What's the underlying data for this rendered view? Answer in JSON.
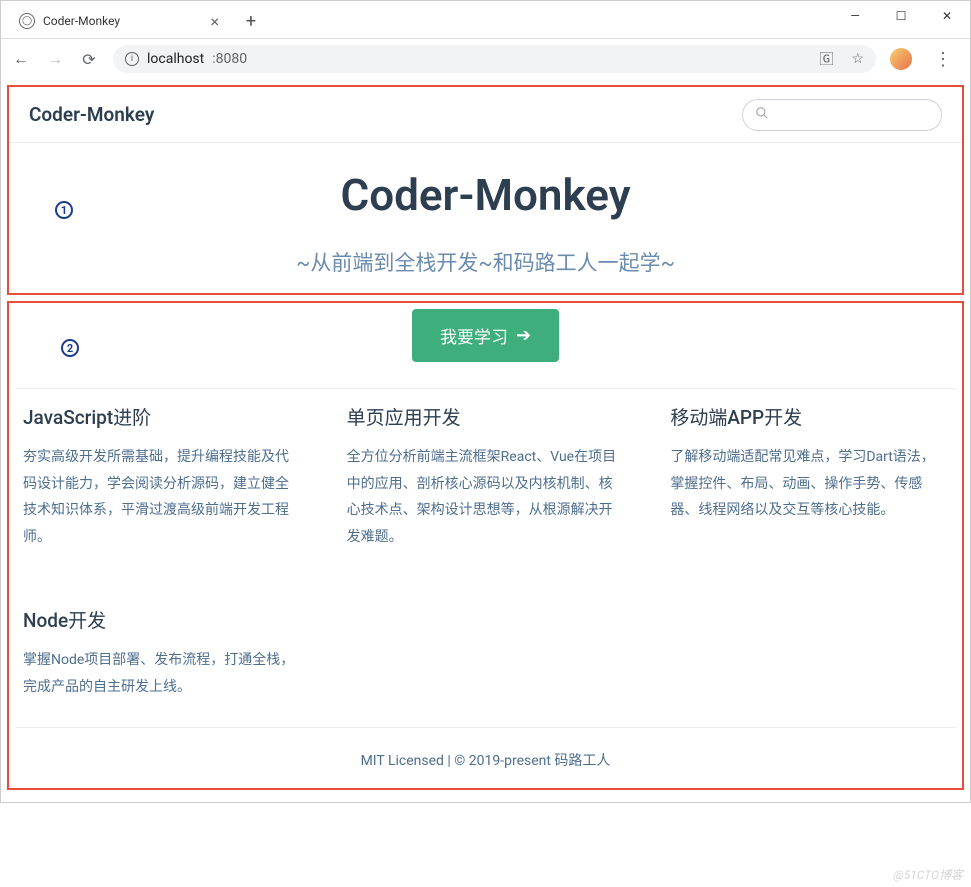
{
  "browser": {
    "tab_title": "Coder-Monkey",
    "url_display": "localhost",
    "url_port": ":8080",
    "window_controls": {
      "min": "—",
      "max": "☐",
      "close": "✕"
    }
  },
  "navbar": {
    "title": "Coder-Monkey"
  },
  "hero": {
    "title": "Coder-Monkey",
    "subtitle": "~从前端到全栈开发~和码路工人一起学~"
  },
  "cta": {
    "label": "我要学习"
  },
  "features": [
    {
      "title": "JavaScript进阶",
      "desc": "夯实高级开发所需基础，提升编程技能及代码设计能力，学会阅读分析源码，建立健全技术知识体系，平滑过渡高级前端开发工程师。"
    },
    {
      "title": "单页应用开发",
      "desc": "全方位分析前端主流框架React、Vue在项目中的应用、剖析核心源码以及内核机制、核心技术点、架构设计思想等，从根源解决开发难题。"
    },
    {
      "title": "移动端APP开发",
      "desc": "了解移动端适配常见难点，学习Dart语法，掌握控件、布局、动画、操作手势、传感器、线程网络以及交互等核心技能。"
    },
    {
      "title": "Node开发",
      "desc": "掌握Node项目部署、发布流程，打通全栈，完成产品的自主研发上线。"
    }
  ],
  "footer": {
    "text": "MIT Licensed | © 2019-present 码路工人"
  },
  "markers": {
    "one": "1",
    "two": "2"
  },
  "watermark": "@51CTO博客"
}
